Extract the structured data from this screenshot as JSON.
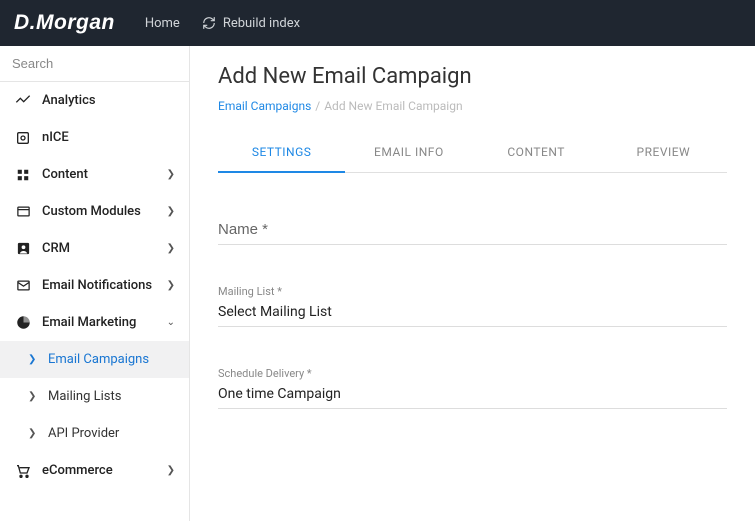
{
  "brand": "D.Morgan",
  "topnav": {
    "home": "Home",
    "rebuild": "Rebuild index"
  },
  "search": {
    "placeholder": "Search"
  },
  "sidebar": {
    "items": [
      {
        "label": "Analytics"
      },
      {
        "label": "nICE"
      },
      {
        "label": "Content"
      },
      {
        "label": "Custom Modules"
      },
      {
        "label": "CRM"
      },
      {
        "label": "Email Notifications"
      },
      {
        "label": "Email Marketing"
      },
      {
        "label": "eCommerce"
      }
    ],
    "submenu": [
      {
        "label": "Email Campaigns"
      },
      {
        "label": "Mailing Lists"
      },
      {
        "label": "API Provider"
      }
    ]
  },
  "page": {
    "title": "Add New Email Campaign",
    "breadcrumb": {
      "link": "Email Campaigns",
      "current": "Add New Email Campaign"
    }
  },
  "tabs": [
    {
      "label": "SETTINGS"
    },
    {
      "label": "EMAIL INFO"
    },
    {
      "label": "CONTENT"
    },
    {
      "label": "PREVIEW"
    }
  ],
  "form": {
    "name": {
      "placeholder": "Name *"
    },
    "mailing_list": {
      "label": "Mailing List *",
      "value": "Select Mailing List"
    },
    "schedule": {
      "label": "Schedule Delivery *",
      "value": "One time Campaign"
    }
  }
}
